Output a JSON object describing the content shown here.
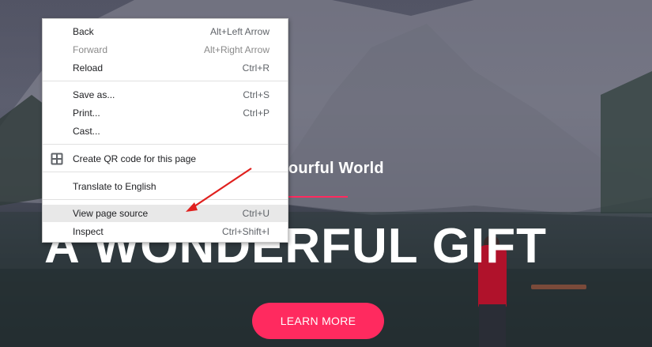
{
  "hero": {
    "subtitle": "e Colourful World",
    "headline": "A WONDERFUL GIFT",
    "cta_label": "LEARN MORE",
    "accent_color": "#ff2a5f"
  },
  "context_menu": {
    "items": [
      {
        "label": "Back",
        "shortcut": "Alt+Left Arrow"
      },
      {
        "label": "Forward",
        "shortcut": "Alt+Right Arrow",
        "disabled": true
      },
      {
        "label": "Reload",
        "shortcut": "Ctrl+R"
      },
      {
        "label": "Save as...",
        "shortcut": "Ctrl+S"
      },
      {
        "label": "Print...",
        "shortcut": "Ctrl+P"
      },
      {
        "label": "Cast...",
        "shortcut": ""
      },
      {
        "label": "Create QR code for this page",
        "shortcut": "",
        "icon": "qr-code-icon"
      },
      {
        "label": "Translate to English",
        "shortcut": ""
      },
      {
        "label": "View page source",
        "shortcut": "Ctrl+U",
        "highlighted": true
      },
      {
        "label": "Inspect",
        "shortcut": "Ctrl+Shift+I"
      }
    ]
  },
  "annotation": {
    "arrow_color": "#e0201e"
  }
}
